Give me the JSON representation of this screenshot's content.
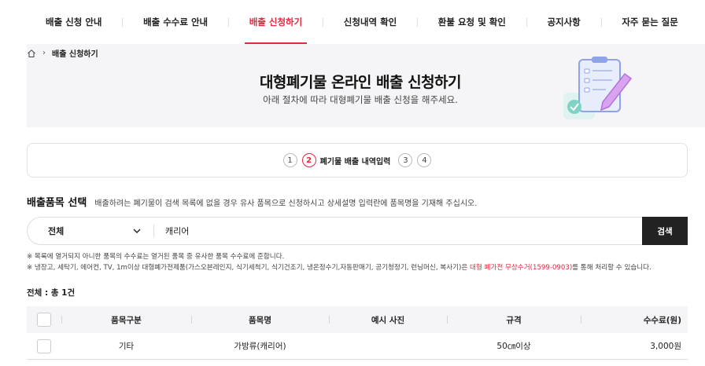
{
  "nav": {
    "items": [
      {
        "label": "배출 신청 안내"
      },
      {
        "label": "배출 수수료 안내"
      },
      {
        "label": "배출 신청하기"
      },
      {
        "label": "신청내역 확인"
      },
      {
        "label": "환불 요청 및 확인"
      },
      {
        "label": "공지사항"
      },
      {
        "label": "자주 묻는 질문"
      }
    ],
    "active_index": 2
  },
  "breadcrumb": {
    "chevron": "›",
    "current": "배출 신청하기"
  },
  "hero": {
    "title": "대형폐기물 온라인 배출 신청하기",
    "subtitle": "아래 절차에 따라 대형폐기물 배출 신청을 해주세요."
  },
  "steps": {
    "s1": "1",
    "s2": "2",
    "s2_label": "폐기물 배출 내역입력",
    "s3": "3",
    "s4": "4",
    "active": 2
  },
  "section": {
    "title": "배출품목 선택",
    "desc": "배출하려는 폐기물이 검색 목록에 없을 경우 유사 품목으로 신청하시고 상세설명 입력란에 품목명을 기재해 주십시오."
  },
  "search": {
    "category": "전체",
    "query": "캐리어",
    "button": "검색"
  },
  "notes": {
    "line1": "※ 목록에 열거되지 아니한 품목의 수수료는 열거된 품목 중 유사한 품목 수수료에 준합니다.",
    "line2_pre": "※ 냉장고, 세탁기, 에어컨, TV, 1m이상 대형폐가전제품(가스오븐레인지, 식기세척기, 식기건조기, 냉온정수기,자동판매기, 공기청정기, 런닝머신, 복사기)은 ",
    "line2_hl": "대형 폐가전 무상수거(1599-0903)",
    "line2_post": "를 통해 처리할 수 있습니다."
  },
  "total": "전체 : 총 1건",
  "table": {
    "headers": [
      "품목구분",
      "품목명",
      "예시 사진",
      "규격",
      "수수료(원)"
    ],
    "rows": [
      {
        "category": "기타",
        "name": "가방류(캐리어)",
        "photo": "",
        "spec": "50㎝이상",
        "fee": "3,000원"
      }
    ]
  },
  "colors": {
    "accent": "#e4293f",
    "button": "#222222",
    "hero_bg": "#f5f5f7"
  }
}
